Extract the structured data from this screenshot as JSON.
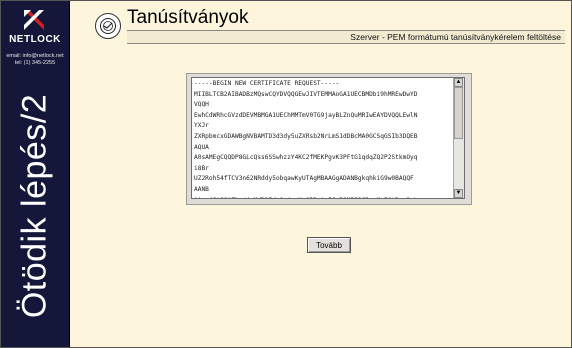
{
  "sidebar": {
    "logo_text": "NETLOCK",
    "contact_email": "email: info@netlock.net",
    "contact_phone": "tel: (1) 345-2255",
    "vertical_title": "Ötödik lépés/2"
  },
  "header": {
    "title": "Tanúsítványok",
    "subtitle": "Szerver - PEM formátumú tanúsítványkérelem feltöltése",
    "icon": "certificate-seal-icon"
  },
  "cert_request": {
    "lines": [
      "-----BEGIN NEW CERTIFICATE REQUEST-----",
      "MIIBLTCB2AIBADBzMQswCQYDVQQGEwJIVTEMMAoGA1UECBMDbi9hMREwDwYD",
      "VQQH",
      "EwhCdWRhcGVzdDEVMBMGA1UEChMMTmV0TG9jayBLZnQuMRIwEAYDVQQLEwlN",
      "YXJr",
      "ZXRpbmcxGDAWBgNVBAMTD3d3dy5uZXRsb2NrLmS1dDBcMA0GCSqGSIb3DQEB",
      "AQUA",
      "A0sAMEgCQQDP8GLcQss6SSwhzzY4KC2fMEKPgvK3PFtG1qdqZQ2P2StkmOyq",
      "i8Br",
      "UZ2Roh54fTCV3n62NRddy5obqawKyUTAgMBAAGgADANBgkqhkiG9w0BAQQF",
      "AANB",
      "AAnp4JtJ8AZhn/4aMdD3IdsOxjwnKuQBRwjaICoBQMIJ3GRzwM+50tDsx2qL",
      "ToIF"
    ]
  },
  "actions": {
    "next_label": "Tovább"
  },
  "colors": {
    "sidebar_bg": "#14163a",
    "page_bg": "#fdf5dc"
  }
}
